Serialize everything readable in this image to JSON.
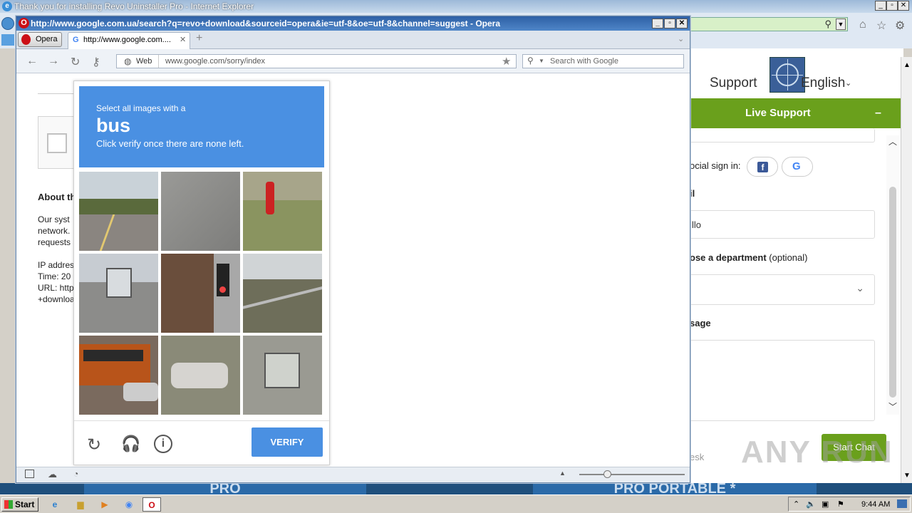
{
  "ie": {
    "title": "Thank you for installing Revo Uninstaller Pro - Internet Explorer",
    "nav_support": "Support",
    "nav_language": "English",
    "live_support_title": "Live Support",
    "live_support_minimize": "–",
    "social_signin": "ocial sign in:",
    "email_label": "il",
    "email_value": "llo",
    "dept_label_bold": "ose a department",
    "dept_label_opt": "(optional)",
    "message_label": "sage",
    "footer_link": "esk",
    "start_chat": "Start Chat",
    "banner_left": "PRO",
    "banner_right": "PRO PORTABLE *",
    "watermark": "ANY RUN"
  },
  "opera": {
    "title": "http://www.google.com.ua/search?q=revo+download&sourceid=opera&ie=utf-8&oe=utf-8&channel=suggest - Opera",
    "menu_label": "Opera",
    "tab_label": "http://www.google.com....",
    "web_label": "Web",
    "url": "www.google.com/sorry/index",
    "search_placeholder": "Search with Google"
  },
  "sorry_page": {
    "about_heading": "About th",
    "para1": [
      "Our syst",
      "network.",
      "requests"
    ],
    "ip_lines": [
      "IP addres",
      "Time: 20",
      "URL: http",
      "+downloa"
    ]
  },
  "captcha": {
    "instruction_small": "Select all images with a",
    "target_word": "bus",
    "instruction_sub": "Click verify once there are none left.",
    "verify_label": "VERIFY",
    "tiles": [
      {
        "name": "road-palm-trees"
      },
      {
        "name": "asphalt-road"
      },
      {
        "name": "fire-hydrant"
      },
      {
        "name": "highway-bus"
      },
      {
        "name": "traffic-light"
      },
      {
        "name": "bridge-guardrail"
      },
      {
        "name": "school-bus"
      },
      {
        "name": "parked-car"
      },
      {
        "name": "street-van"
      }
    ]
  },
  "taskbar": {
    "start_label": "Start",
    "clock": "9:44 AM"
  }
}
